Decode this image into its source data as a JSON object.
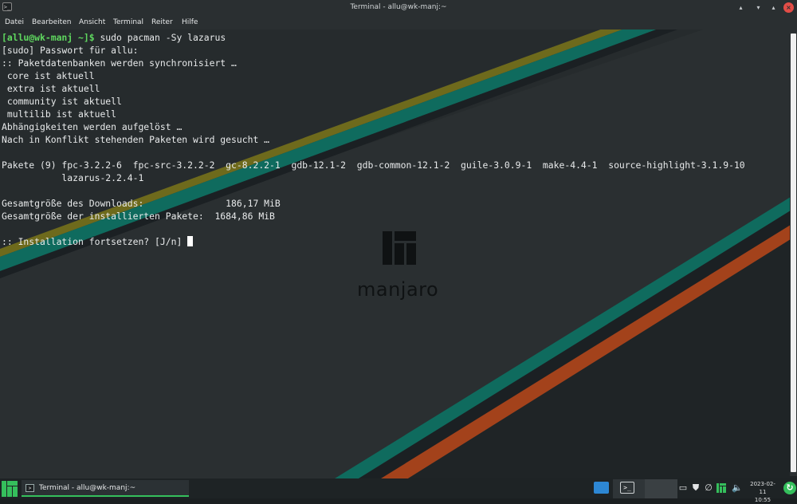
{
  "window": {
    "title": "Terminal - allu@wk-manj:~",
    "app_icon_glyph": ">_",
    "buttons": {
      "shade": "▴",
      "minimize": "▾",
      "maximize": "▴",
      "close": "×"
    }
  },
  "menu": {
    "items": [
      "Datei",
      "Bearbeiten",
      "Ansicht",
      "Terminal",
      "Reiter",
      "Hilfe"
    ]
  },
  "terminal": {
    "prompt": "[allu@wk-manj ~]$",
    "command": " sudo pacman -Sy lazarus",
    "lines": [
      "[sudo] Passwort für allu:",
      ":: Paketdatenbanken werden synchronisiert …",
      " core ist aktuell",
      " extra ist aktuell",
      " community ist aktuell",
      " multilib ist aktuell",
      "Abhängigkeiten werden aufgelöst …",
      "Nach in Konflikt stehenden Paketen wird gesucht …",
      "",
      "Pakete (9) fpc-3.2.2-6  fpc-src-3.2.2-2  gc-8.2.2-1  gdb-12.1-2  gdb-common-12.1-2  guile-3.0.9-1  make-4.4-1  source-highlight-3.1.9-10",
      "           lazarus-2.2.4-1",
      "",
      "Gesamtgröße des Downloads:               186,17 MiB",
      "Gesamtgröße der installierten Pakete:  1684,86 MiB",
      ""
    ],
    "question": ":: Installation fortsetzen? [J/n] ",
    "background_logo_text": "manjaro"
  },
  "taskbar": {
    "task_label": "Terminal - allu@wk-manj:~",
    "clock_date": "2023-02-11",
    "clock_time": "10:55"
  },
  "colors": {
    "accent": "#35bf5c",
    "prompt_green": "#5fd75f",
    "close_red": "#e24d47"
  }
}
